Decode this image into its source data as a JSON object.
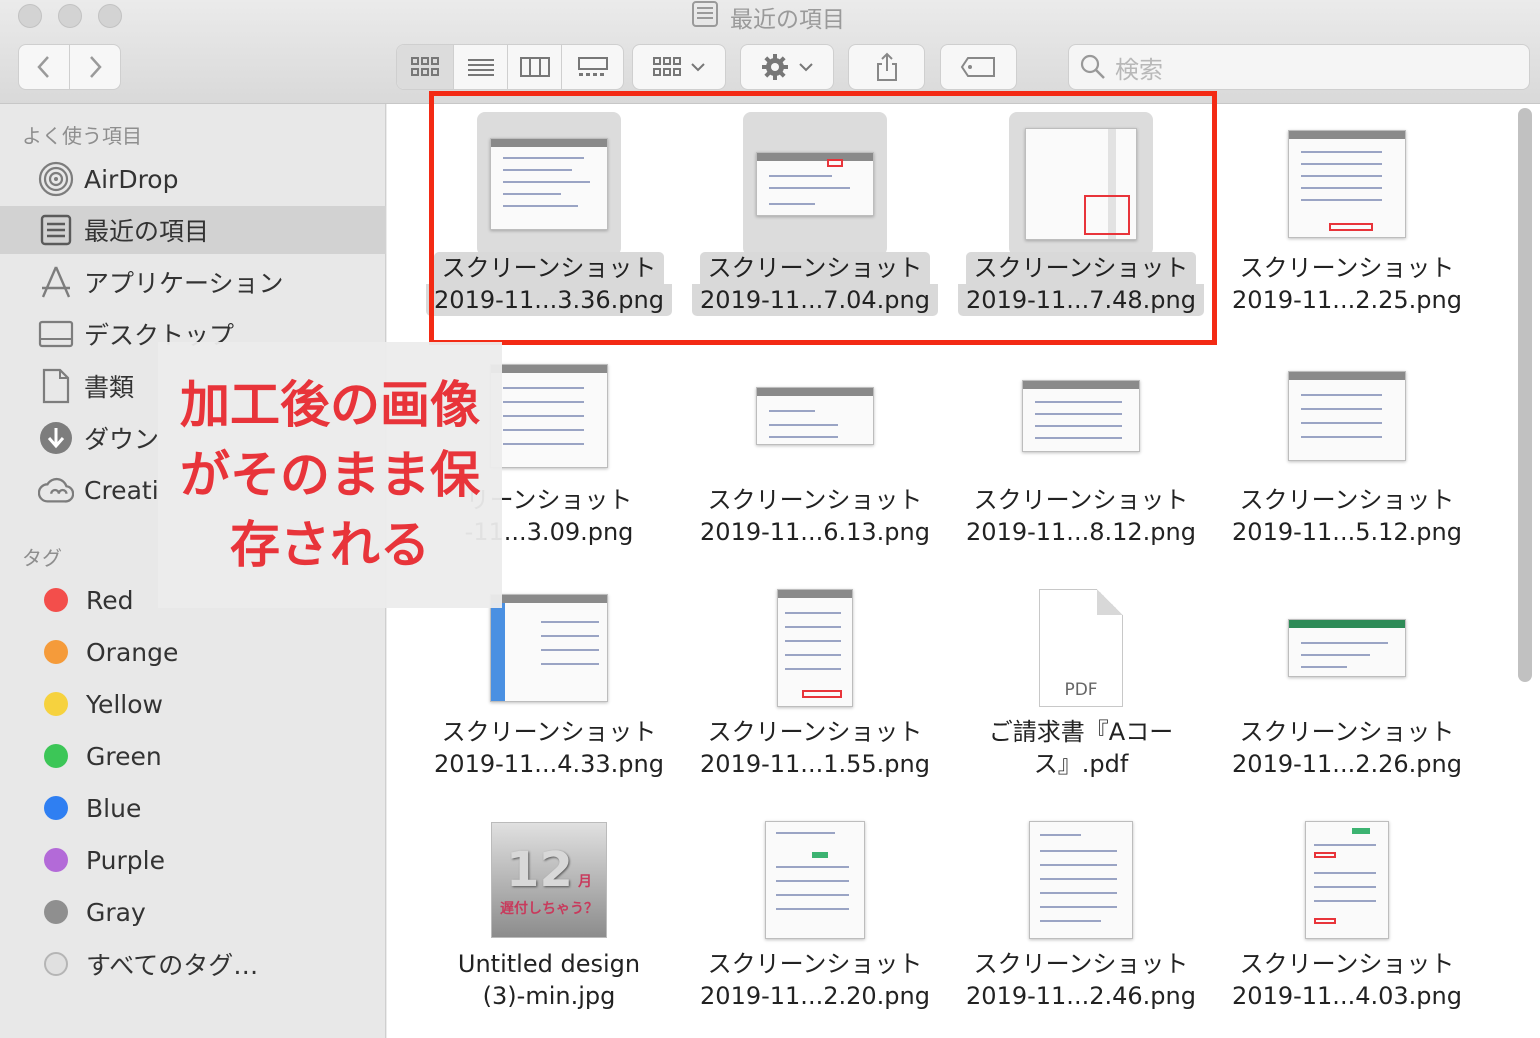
{
  "window": {
    "title": "最近の項目"
  },
  "toolbar": {
    "search_placeholder": "検索"
  },
  "sidebar": {
    "favorites_heading": "よく使う項目",
    "favorites": [
      {
        "label": "AirDrop",
        "icon": "airdrop-icon"
      },
      {
        "label": "最近の項目",
        "icon": "recents-icon",
        "selected": true
      },
      {
        "label": "アプリケーション",
        "icon": "applications-icon"
      },
      {
        "label": "デスクトップ",
        "icon": "desktop-icon"
      },
      {
        "label": "書類",
        "icon": "documents-icon"
      },
      {
        "label": "ダウン",
        "icon": "downloads-icon"
      },
      {
        "label": "Creati",
        "icon": "creative-cloud-icon"
      }
    ],
    "tags_heading": "タグ",
    "tags": [
      {
        "label": "Red",
        "color": "#f34e4b"
      },
      {
        "label": "Orange",
        "color": "#f59b3a"
      },
      {
        "label": "Yellow",
        "color": "#f6d23e"
      },
      {
        "label": "Green",
        "color": "#3cc657"
      },
      {
        "label": "Blue",
        "color": "#2f7ff2"
      },
      {
        "label": "Purple",
        "color": "#b36ad8"
      },
      {
        "label": "Gray",
        "color": "#8f8f8f"
      },
      {
        "label": "すべてのタグ…",
        "color": "#e0e0e0"
      }
    ]
  },
  "annotation": {
    "line1": "加工後の画像",
    "line2": "がそのまま保",
    "line3": "存される"
  },
  "files": [
    {
      "line1": "スクリーンショット",
      "line2": "2019-11...3.36.png"
    },
    {
      "line1": "スクリーンショット",
      "line2": "2019-11...7.04.png"
    },
    {
      "line1": "スクリーンショット",
      "line2": "2019-11...7.48.png"
    },
    {
      "line1": "スクリーンショット",
      "line2": "2019-11...2.25.png"
    },
    {
      "line1": "リーンショット",
      "line2": "-11...3.09.png"
    },
    {
      "line1": "スクリーンショット",
      "line2": "2019-11...6.13.png"
    },
    {
      "line1": "スクリーンショット",
      "line2": "2019-11...8.12.png"
    },
    {
      "line1": "スクリーンショット",
      "line2": "2019-11...5.12.png"
    },
    {
      "line1": "スクリーンショット",
      "line2": "2019-11...4.33.png"
    },
    {
      "line1": "スクリーンショット",
      "line2": "2019-11...1.55.png"
    },
    {
      "line1": "ご請求書『Aコー",
      "line2": "ス』.pdf",
      "thumb_label": "PDF"
    },
    {
      "line1": "スクリーンショット",
      "line2": "2019-11...2.26.png"
    },
    {
      "line1": "Untitled design",
      "line2": "(3)-min.jpg",
      "thumb_num": "12",
      "thumb_unit": "月",
      "thumb_caption": "遅付しちゃう？"
    },
    {
      "line1": "スクリーンショット",
      "line2": "2019-11...2.20.png"
    },
    {
      "line1": "スクリーンショット",
      "line2": "2019-11...2.46.png"
    },
    {
      "line1": "スクリーンショット",
      "line2": "2019-11...4.03.png"
    }
  ]
}
